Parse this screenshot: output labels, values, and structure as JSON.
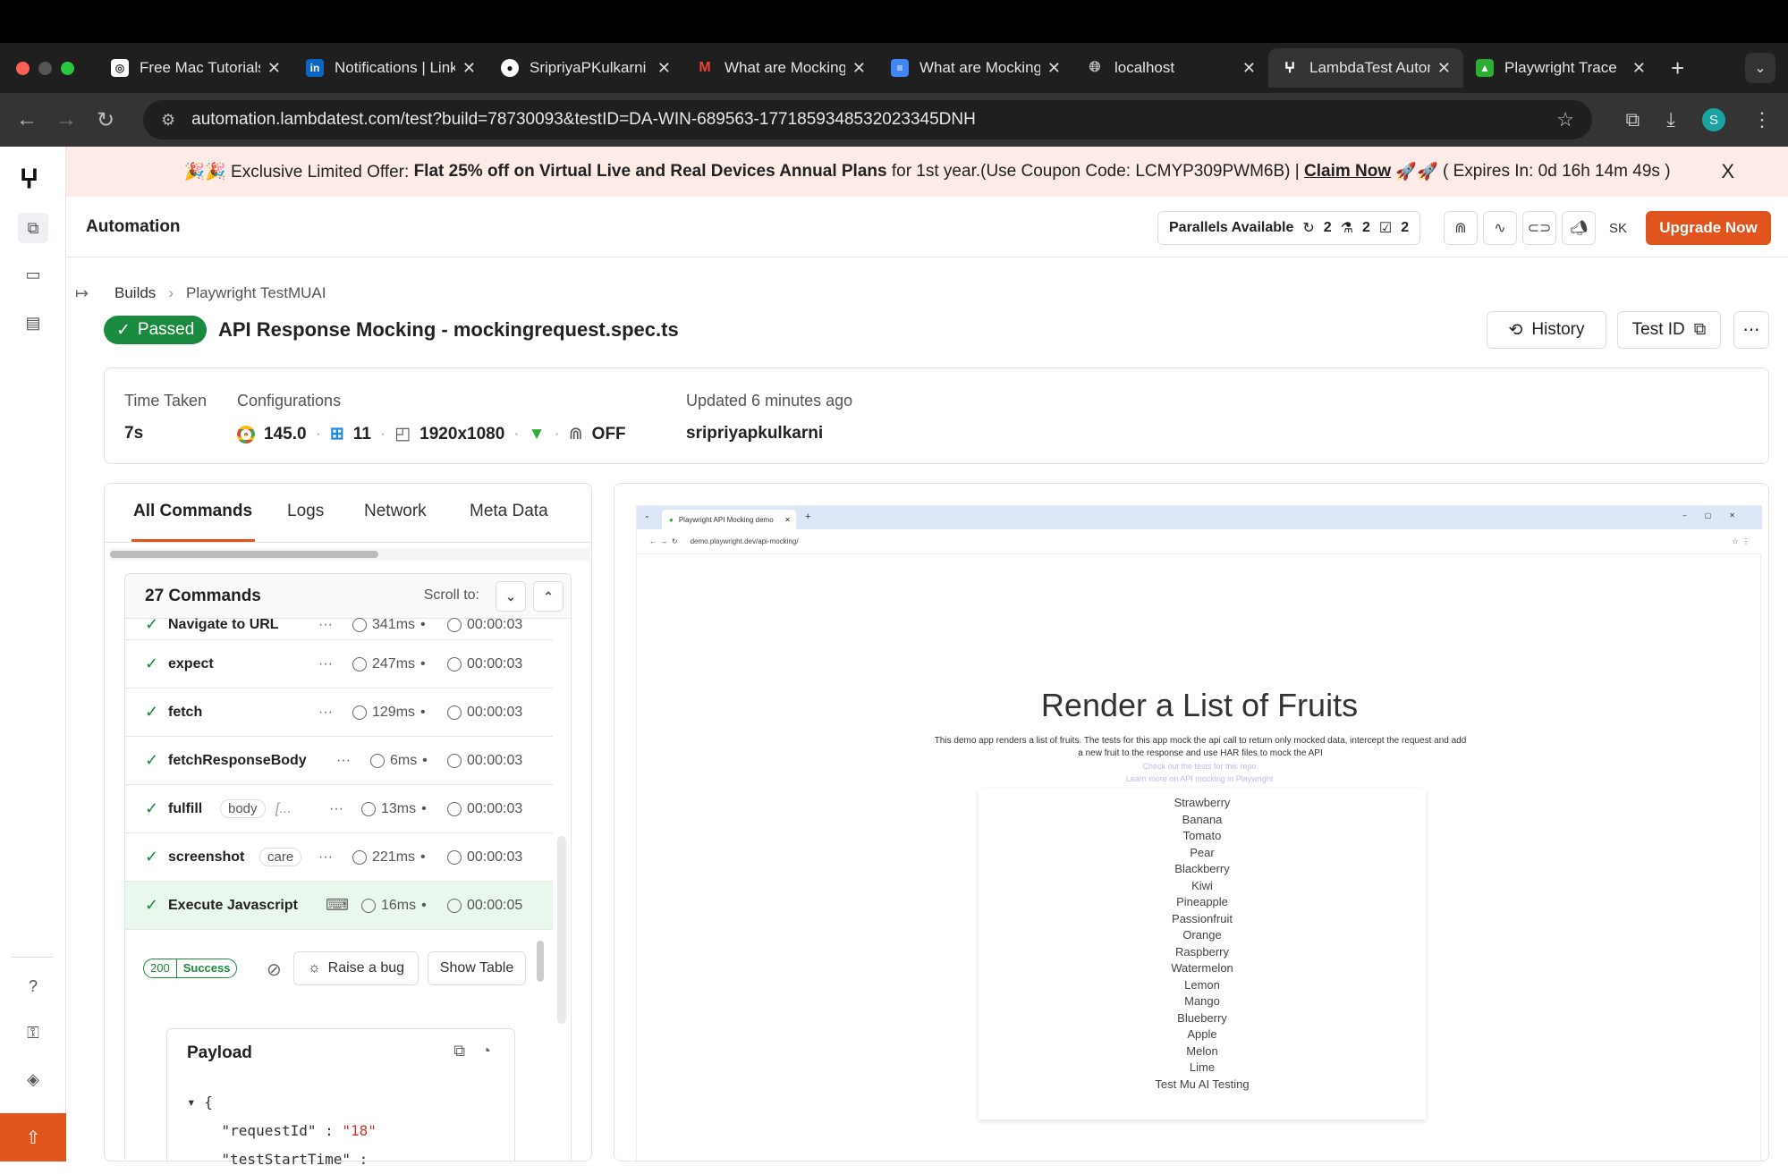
{
  "browser": {
    "tabs": [
      {
        "title": "Free Mac Tutorials",
        "icon": "tutorial-icon",
        "color": "#ffffff"
      },
      {
        "title": "Notifications | LinkedIn",
        "icon": "linkedin-icon",
        "color": "#0a66c2"
      },
      {
        "title": "SripriyaPKulkarni",
        "icon": "github-icon",
        "color": "#ffffff"
      },
      {
        "title": "What are Mocking",
        "icon": "gmail-icon",
        "color": "#ea4335"
      },
      {
        "title": "What are Mocking",
        "icon": "docs-icon",
        "color": "#4285f4"
      },
      {
        "title": "localhost",
        "icon": "globe-icon",
        "color": "#bbbbbb"
      },
      {
        "title": "LambdaTest Automation",
        "icon": "lambdatest-icon",
        "color": "#ffffff"
      },
      {
        "title": "Playwright Trace",
        "icon": "playwright-icon",
        "color": "#2ead33"
      }
    ],
    "url": "automation.lambdatest.com/test?build=78730093&testID=DA-WIN-689563-1771859348532023345DNH",
    "profile_initial": "S"
  },
  "banner": {
    "prefix": "🎉🎉 Exclusive Limited Offer:",
    "bold": "Flat 25% off on Virtual Live and Real Devices Annual Plans",
    "suffix": "for 1st year.(Use Coupon Code: LCMYP309PWM6B) |",
    "cta": "Claim Now",
    "emoji": "🚀🚀",
    "expires": "( Expires In: 0d 16h 14m 49s )",
    "close": "X"
  },
  "header": {
    "title": "Automation",
    "parallels_label": "Parallels Available",
    "parallels": [
      "2",
      "2",
      "2"
    ],
    "user_initials": "SK",
    "upgrade_label": "Upgrade Now"
  },
  "breadcrumb": {
    "builds": "Builds",
    "current": "Playwright TestMUAI"
  },
  "test": {
    "status": "Passed",
    "name": "API Response Mocking - mockingrequest.spec.ts",
    "history_label": "History",
    "testid_label": "Test ID"
  },
  "info": {
    "time_taken_label": "Time Taken",
    "time_taken": "7s",
    "config_label": "Configurations",
    "browser_version": "145.0",
    "os_version": "11",
    "resolution": "1920x1080",
    "tunnel": "OFF",
    "updated_label": "Updated 6 minutes ago",
    "user": "sripriyapkulkarni"
  },
  "panel_tabs": [
    "All Commands",
    "Logs",
    "Network",
    "Meta Data"
  ],
  "commands": {
    "count_label": "27 Commands",
    "scroll_to_label": "Scroll to:",
    "rows": [
      {
        "name": "Navigate to URL",
        "chip": "",
        "duration": "341ms",
        "time": "00:00:03"
      },
      {
        "name": "expect",
        "chip": "",
        "duration": "247ms",
        "time": "00:00:03"
      },
      {
        "name": "fetch",
        "chip": "",
        "duration": "129ms",
        "time": "00:00:03"
      },
      {
        "name": "fetchResponseBody",
        "chip": "",
        "duration": "6ms",
        "time": "00:00:03"
      },
      {
        "name": "fulfill",
        "chip": "body",
        "extra": "[...",
        "duration": "13ms",
        "time": "00:00:03"
      },
      {
        "name": "screenshot",
        "chip": "care",
        "duration": "221ms",
        "time": "00:00:03"
      },
      {
        "name": "Execute Javascript",
        "chip": "",
        "duration": "16ms",
        "time": "00:00:05"
      }
    ],
    "status_code": "200",
    "status_text": "Success",
    "raise_bug_label": "Raise a bug",
    "show_table_label": "Show Table"
  },
  "payload": {
    "title": "Payload",
    "lines": [
      {
        "text": "{"
      },
      {
        "key": "\"requestId\"",
        "value": "\"18\""
      },
      {
        "key": "\"testStartTime\"",
        "value": ""
      }
    ]
  },
  "screenshot": {
    "tab_title": "Playwright API Mocking demo",
    "url": "demo.playwright.dev/api-mocking/",
    "heading": "Render a List of Fruits",
    "description": "This demo app renders a list of fruits. The tests for this app mock the api call to return only mocked data, intercept the request and add a new fruit to the response and use HAR files to mock the API",
    "link1": "Check out the tests for this repo",
    "link2": "Learn more on API mocking in Playwright",
    "fruits": [
      "Strawberry",
      "Banana",
      "Tomato",
      "Pear",
      "Blackberry",
      "Kiwi",
      "Pineapple",
      "Passionfruit",
      "Orange",
      "Raspberry",
      "Watermelon",
      "Lemon",
      "Mango",
      "Blueberry",
      "Apple",
      "Melon",
      "Lime",
      "Test Mu AI Testing"
    ]
  },
  "colors": {
    "accent": "#e2541d",
    "success": "#1a8a3e",
    "banner_bg": "#fcebe6"
  }
}
